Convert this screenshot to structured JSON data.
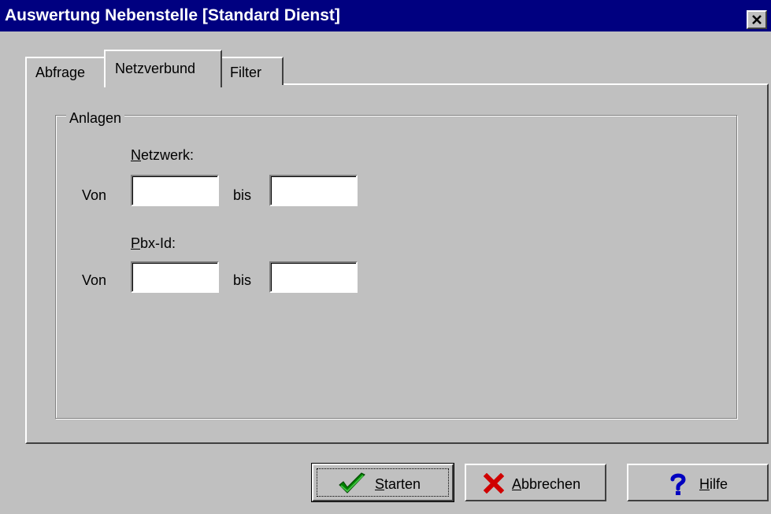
{
  "window": {
    "title": "Auswertung Nebenstelle [Standard Dienst]",
    "close_icon": "close-icon"
  },
  "tabs": [
    {
      "label": "Abfrage",
      "active": false
    },
    {
      "label": "Netzverbund",
      "active": true
    },
    {
      "label": "Filter",
      "active": false
    }
  ],
  "group": {
    "legend": "Anlagen",
    "netzwerk": {
      "heading_first": "N",
      "heading_rest": "etzwerk:",
      "von_label": "Von",
      "bis_label": "bis",
      "von_value": "",
      "bis_value": ""
    },
    "pbx": {
      "heading_first": "P",
      "heading_rest": "bx-Id:",
      "von_label": "Von",
      "bis_label": "bis",
      "von_value": "",
      "bis_value": ""
    }
  },
  "buttons": {
    "start": {
      "mnemonic": "S",
      "rest": "tarten",
      "icon": "checkmark-icon",
      "icon_color": "#008000"
    },
    "cancel": {
      "mnemonic": "A",
      "rest": "bbrechen",
      "icon": "x-icon",
      "icon_color": "#d00000"
    },
    "help": {
      "mnemonic": "H",
      "rest": "ilfe",
      "icon": "question-mark-icon",
      "icon_color": "#0000c0"
    }
  },
  "colors": {
    "titlebar": "#000080",
    "face": "#c0c0c0"
  }
}
